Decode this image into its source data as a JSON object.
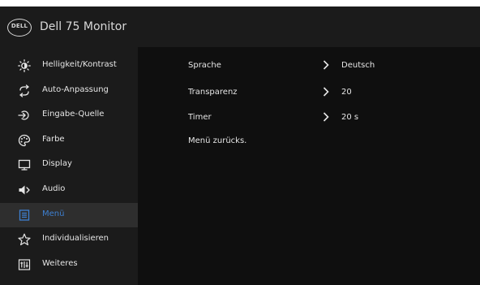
{
  "header": {
    "logo_text": "DELL",
    "title": "Dell 75 Monitor"
  },
  "sidebar": {
    "items": [
      {
        "label": "Helligkeit/Kontrast",
        "icon": "brightness-icon"
      },
      {
        "label": "Auto-Anpassung",
        "icon": "auto-adjust-icon"
      },
      {
        "label": "Eingabe-Quelle",
        "icon": "input-source-icon"
      },
      {
        "label": "Farbe",
        "icon": "color-palette-icon"
      },
      {
        "label": "Display",
        "icon": "display-icon"
      },
      {
        "label": "Audio",
        "icon": "speaker-icon"
      },
      {
        "label": "Menü",
        "icon": "menu-icon",
        "active": true
      },
      {
        "label": "Individualisieren",
        "icon": "star-icon"
      },
      {
        "label": "Weiteres",
        "icon": "others-icon"
      }
    ]
  },
  "menu": {
    "rows": [
      {
        "label": "Sprache",
        "value": "Deutsch"
      },
      {
        "label": "Transparenz",
        "value": "20"
      },
      {
        "label": "Timer",
        "value": "20 s"
      },
      {
        "label": "Menü zurücks.",
        "value": ""
      }
    ]
  },
  "colors": {
    "accent": "#3d7fd0",
    "background": "#0f0f0f",
    "sidebar": "#1b1b1b",
    "active_row": "#2e2e2e",
    "text": "#e6e6e6"
  }
}
